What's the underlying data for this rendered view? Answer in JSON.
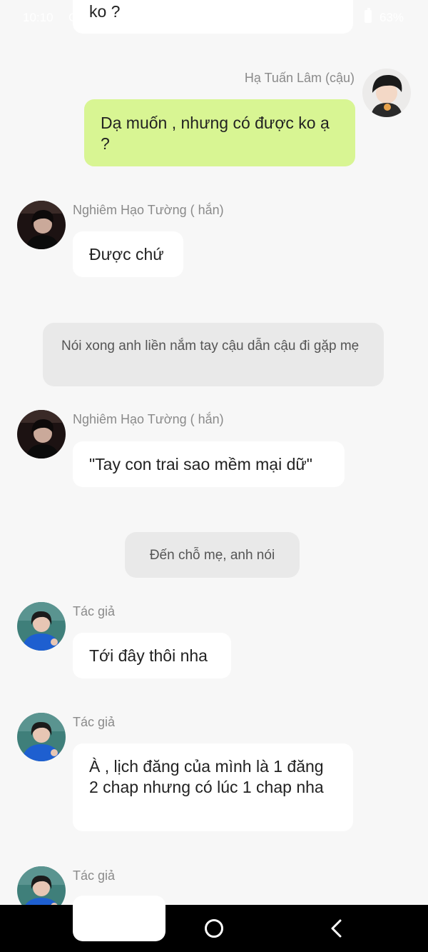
{
  "status_bar": {
    "time": "10:10",
    "extra": "G",
    "signal_text": "l",
    "battery": "63%"
  },
  "messages": [
    {
      "text": "ko ?"
    },
    {
      "sender": "Hạ Tuấn Lâm (cậu)",
      "text": "Dạ muốn , nhưng có được ko ạ ?"
    },
    {
      "sender": "Nghiêm Hạo Tường ( hắn)",
      "text": "Được chứ"
    },
    {
      "narration": "Nói xong anh liền nắm tay cậu dẫn cậu đi gặp mẹ"
    },
    {
      "sender": "Nghiêm Hạo Tường ( hắn)",
      "text": "\"Tay con trai sao mềm mại dữ\""
    },
    {
      "narration": "Đến chỗ mẹ, anh nói"
    },
    {
      "sender": "Tác giả",
      "text": "Tới đây thôi nha"
    },
    {
      "sender": "Tác giả",
      "text": "À , lịch đăng của mình là 1 đăng 2 chap nhưng có lúc 1 chap nha"
    },
    {
      "sender": "Tác giả",
      "text": ""
    }
  ],
  "colors": {
    "background": "#f7f7f7",
    "my_bubble": "#d8f593",
    "other_bubble": "#ffffff",
    "narration": "#e9e9e9",
    "nav_bar": "#000000"
  },
  "nav_bar": {
    "icons": [
      "menu-icon",
      "home-icon",
      "back-icon"
    ]
  }
}
